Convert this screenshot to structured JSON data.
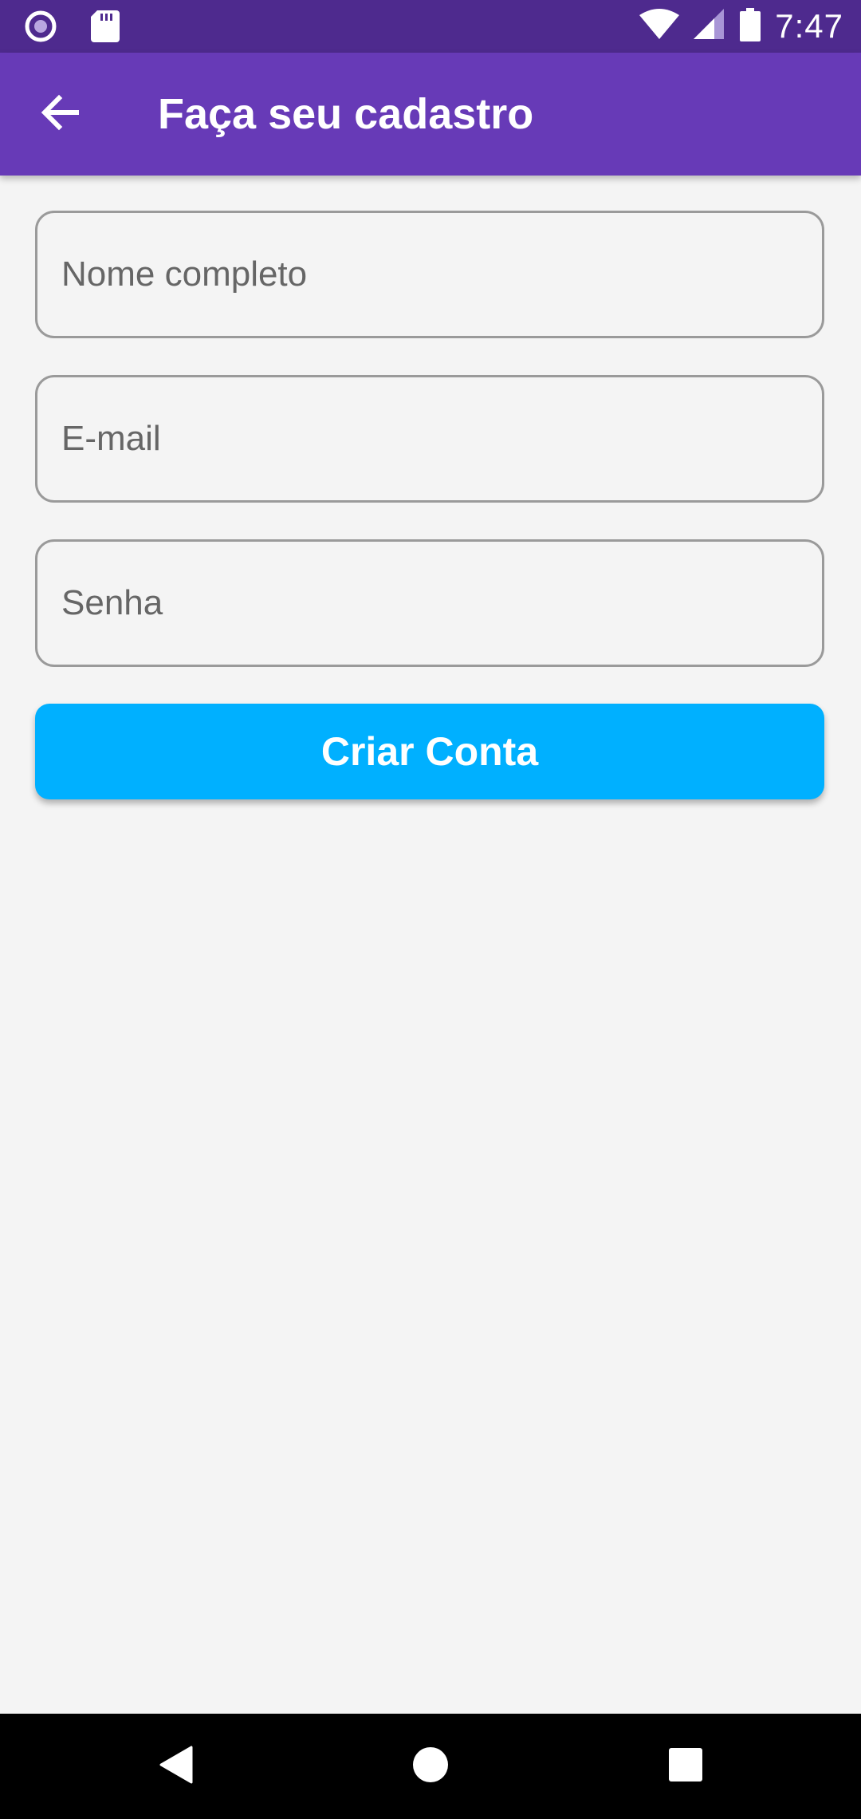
{
  "status_bar": {
    "time": "7:47",
    "icons": [
      "radio-icon",
      "sd-card-icon",
      "wifi-icon",
      "cell-signal-icon",
      "battery-icon"
    ]
  },
  "app_bar": {
    "title": "Faça seu cadastro",
    "back_icon": "arrow-back-icon"
  },
  "form": {
    "name_placeholder": "Nome completo",
    "name_value": "",
    "email_placeholder": "E-mail",
    "email_value": "",
    "password_placeholder": "Senha",
    "password_value": "",
    "submit_label": "Criar Conta"
  },
  "nav_bar": {
    "icons": [
      "back-triangle-icon",
      "home-circle-icon",
      "recents-square-icon"
    ]
  },
  "colors": {
    "status_bar": "#4e2a8e",
    "app_bar": "#673ab7",
    "accent": "#00b0ff",
    "background": "#f4f4f4"
  }
}
